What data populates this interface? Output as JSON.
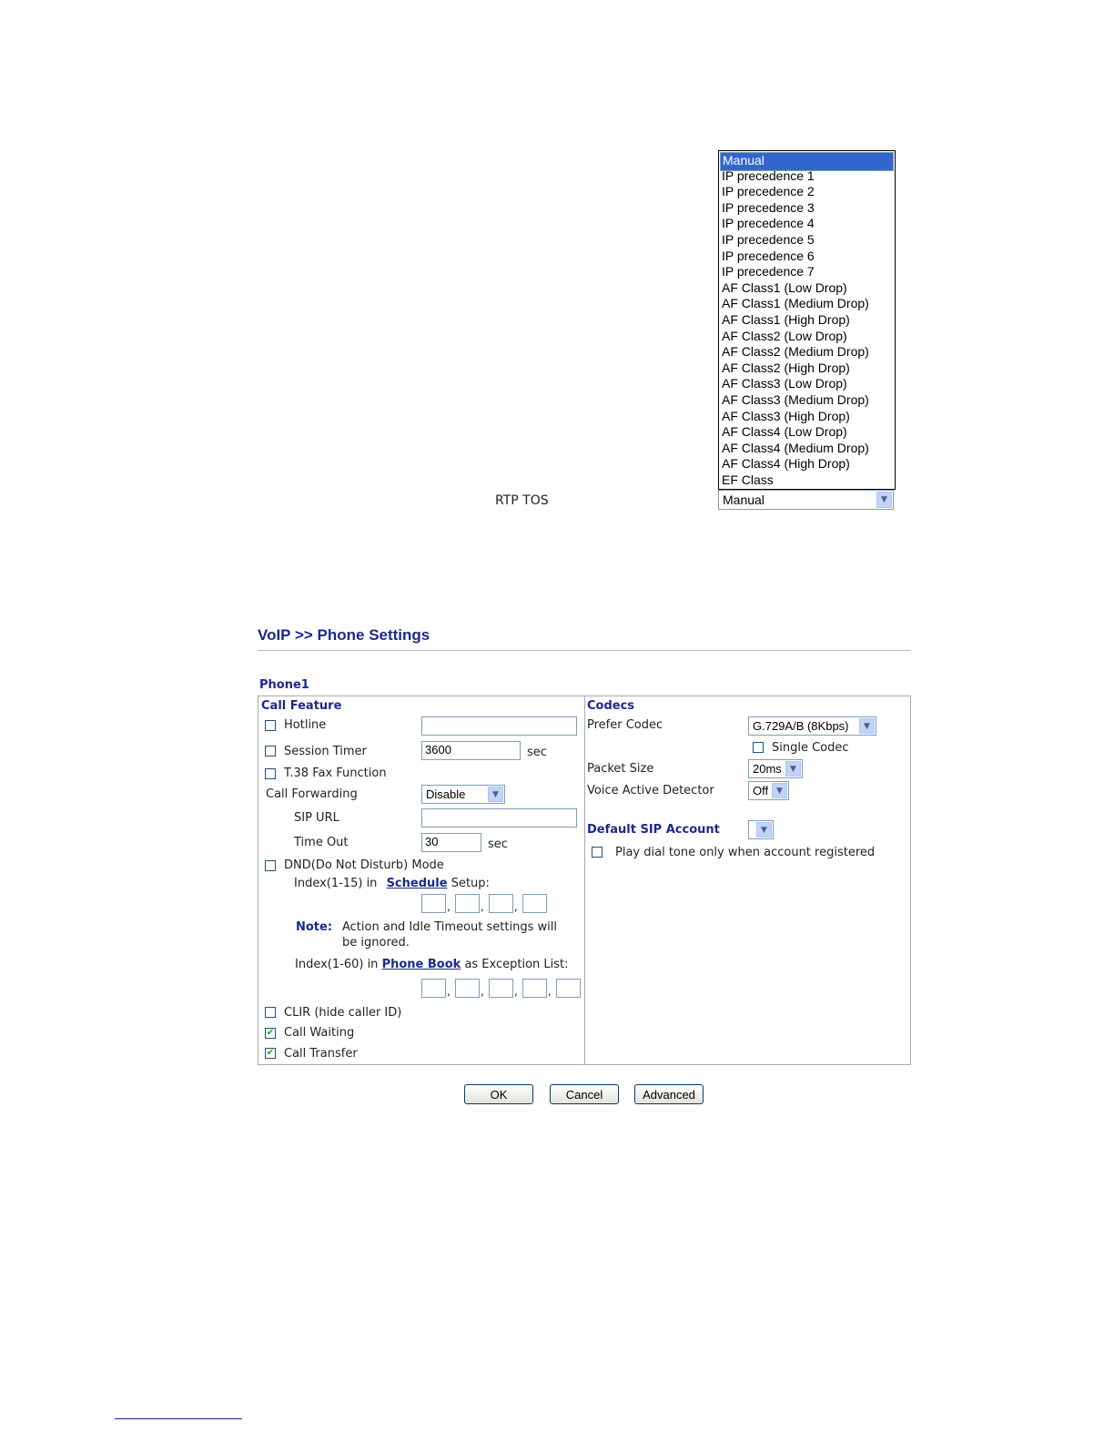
{
  "rtp_tos": {
    "label": "RTP TOS",
    "selected": "Manual",
    "options": [
      "Manual",
      "IP precedence 1",
      "IP precedence 2",
      "IP precedence 3",
      "IP precedence 4",
      "IP precedence 5",
      "IP precedence 6",
      "IP precedence 7",
      "AF Class1 (Low Drop)",
      "AF Class1 (Medium Drop)",
      "AF Class1 (High Drop)",
      "AF Class2 (Low Drop)",
      "AF Class2 (Medium Drop)",
      "AF Class2 (High Drop)",
      "AF Class3 (Low Drop)",
      "AF Class3 (Medium Drop)",
      "AF Class3 (High Drop)",
      "AF Class4 (Low Drop)",
      "AF Class4 (Medium Drop)",
      "AF Class4 (High Drop)",
      "EF Class"
    ]
  },
  "page": {
    "title": "VoIP >> Phone Settings",
    "phone_label": "Phone1"
  },
  "call_feature": {
    "title": "Call Feature",
    "hotline": {
      "label": "Hotline",
      "checked": false,
      "value": ""
    },
    "session_timer": {
      "label": "Session Timer",
      "checked": false,
      "value": "3600",
      "unit": "sec"
    },
    "t38": {
      "label": "T.38 Fax Function",
      "checked": false
    },
    "call_forwarding": {
      "label": "Call Forwarding",
      "value": "Disable"
    },
    "sip_url": {
      "label": "SIP URL",
      "value": ""
    },
    "time_out": {
      "label": "Time Out",
      "value": "30",
      "unit": "sec"
    },
    "dnd": {
      "label": "DND(Do Not Disturb) Mode",
      "checked": false,
      "schedule_prefix": "Index(1-15) in",
      "schedule_link": "Schedule",
      "schedule_suffix": "Setup:",
      "note_label": "Note:",
      "note_text_1": "Action and Idle Timeout settings will",
      "note_text_2": "be ignored.",
      "phonebook_prefix": "Index(1-60) in",
      "phonebook_link": "Phone Book",
      "phonebook_suffix": "as Exception List:"
    },
    "clir": {
      "label": "CLIR (hide caller ID)",
      "checked": false
    },
    "call_waiting": {
      "label": "Call Waiting",
      "checked": true
    },
    "call_transfer": {
      "label": "Call Transfer",
      "checked": true
    }
  },
  "codecs": {
    "title": "Codecs",
    "prefer_codec": {
      "label": "Prefer Codec",
      "value": "G.729A/B (8Kbps)"
    },
    "single_codec": {
      "label": "Single Codec",
      "checked": false
    },
    "packet_size": {
      "label": "Packet Size",
      "value": "20ms"
    },
    "vad": {
      "label": "Voice Active Detector",
      "value": "Off"
    },
    "default_sip": {
      "label": "Default SIP Account",
      "value": ""
    },
    "dial_tone": {
      "label": "Play dial tone only when account registered",
      "checked": false
    }
  },
  "buttons": {
    "ok": "OK",
    "cancel": "Cancel",
    "advanced": "Advanced"
  },
  "colors": {
    "heading": "#1a2a8a",
    "selection": "#3366cc",
    "check_mark": "#21a121"
  }
}
